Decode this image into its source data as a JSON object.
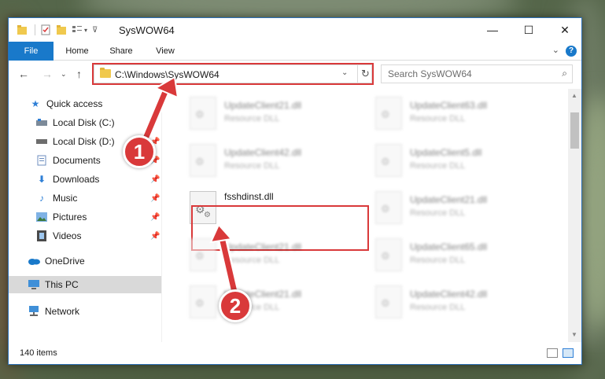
{
  "window": {
    "title": "SysWOW64",
    "minimize": "—",
    "maximize": "☐",
    "close": "✕"
  },
  "ribbon": {
    "tabs": [
      "File",
      "Home",
      "Share",
      "View"
    ],
    "help": "?"
  },
  "nav": {
    "address": "C:\\Windows\\SysWOW64",
    "search_placeholder": "Search SysWOW64"
  },
  "sidebar": {
    "items": [
      {
        "label": "Quick access",
        "icon": "star-icon"
      },
      {
        "label": "Local Disk (C:)",
        "icon": "drive-icon"
      },
      {
        "label": "Local Disk (D:)",
        "icon": "drive-icon"
      },
      {
        "label": "Documents",
        "icon": "document-icon"
      },
      {
        "label": "Downloads",
        "icon": "download-icon"
      },
      {
        "label": "Music",
        "icon": "music-icon"
      },
      {
        "label": "Pictures",
        "icon": "picture-icon"
      },
      {
        "label": "Videos",
        "icon": "video-icon"
      },
      {
        "label": "OneDrive",
        "icon": "cloud-icon"
      },
      {
        "label": "This PC",
        "icon": "computer-icon"
      },
      {
        "label": "Network",
        "icon": "network-icon"
      }
    ]
  },
  "files": [
    {
      "name": "UpdateClient21.dll",
      "type": "Resource DLL"
    },
    {
      "name": "UpdateClient63.dll",
      "type": "Resource DLL"
    },
    {
      "name": "UpdateClient42.dll",
      "type": "Resource DLL"
    },
    {
      "name": "UpdateClient5.dll",
      "type": "Resource DLL"
    },
    {
      "name": "fsshdinst.dll",
      "type": ""
    },
    {
      "name": "UpdateClient21.dll",
      "type": "Resource DLL"
    },
    {
      "name": "UpdateClient21.dll",
      "type": "Resource DLL"
    },
    {
      "name": "UpdateClient65.dll",
      "type": "Resource DLL"
    },
    {
      "name": "UpdateClient21.dll",
      "type": "Resource DLL"
    },
    {
      "name": "UpdateClient42.dll",
      "type": "Resource DLL"
    }
  ],
  "status": {
    "count": "140 items"
  },
  "annotations": {
    "step1": "1",
    "step2": "2",
    "color": "#d9393a"
  }
}
